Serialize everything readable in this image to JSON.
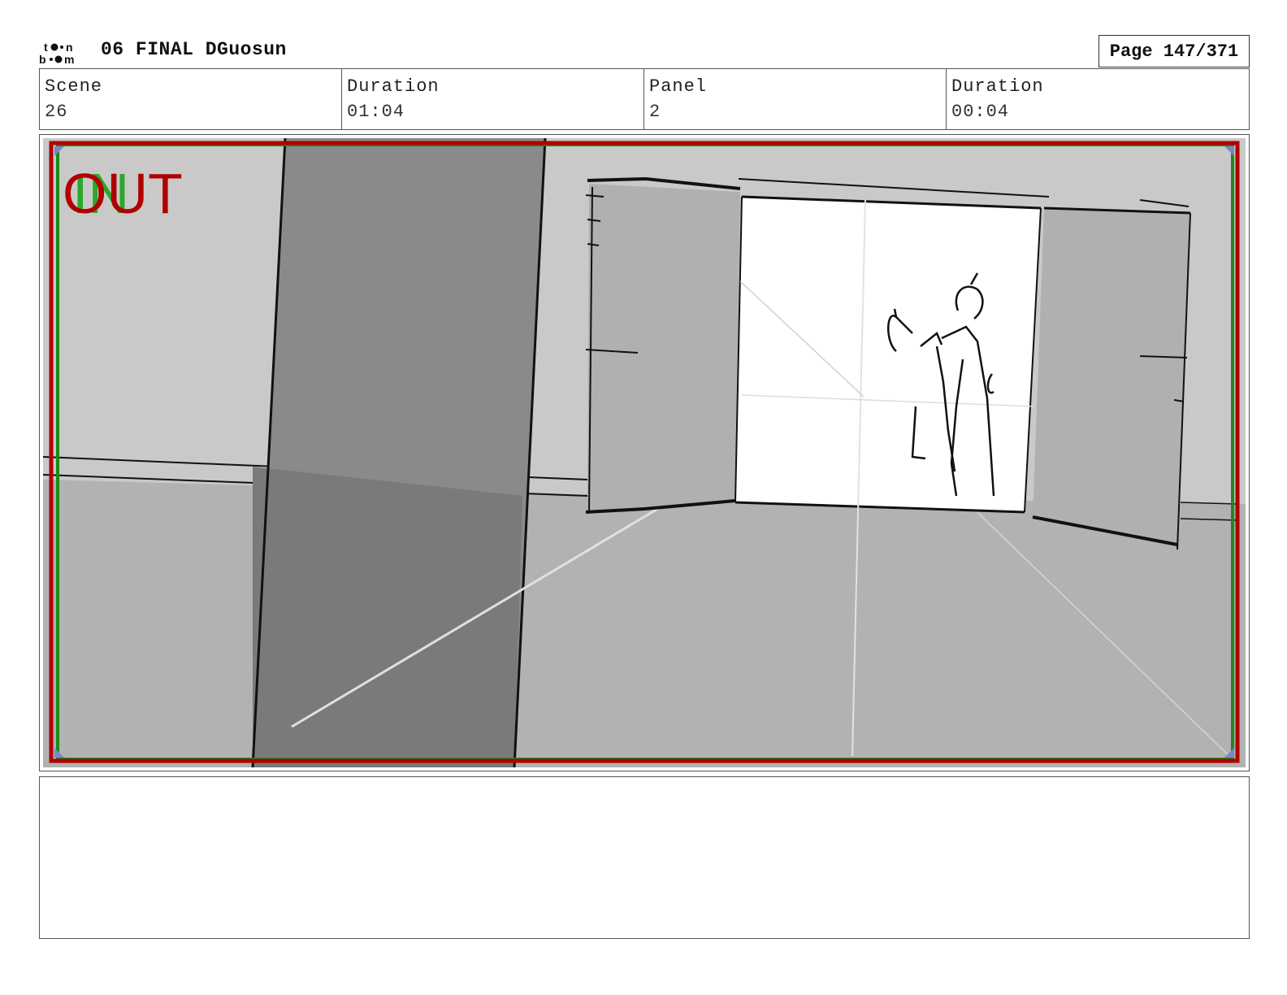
{
  "header": {
    "project_title": "06 FINAL DGuosun",
    "page_label": "Page 147/371"
  },
  "info": [
    {
      "label": "Scene",
      "value": "26"
    },
    {
      "label": "Duration",
      "value": "01:04"
    },
    {
      "label": "Panel",
      "value": "2"
    },
    {
      "label": "Duration",
      "value": "00:04"
    }
  ],
  "panel": {
    "overlay_in": "IN",
    "overlay_out": "OUT",
    "colors": {
      "safe_frame": "#b00000",
      "title_safe": "#1a8a1a",
      "in_text": "#2aa82a",
      "out_text": "#b00000"
    }
  },
  "notes": {
    "text": ""
  }
}
